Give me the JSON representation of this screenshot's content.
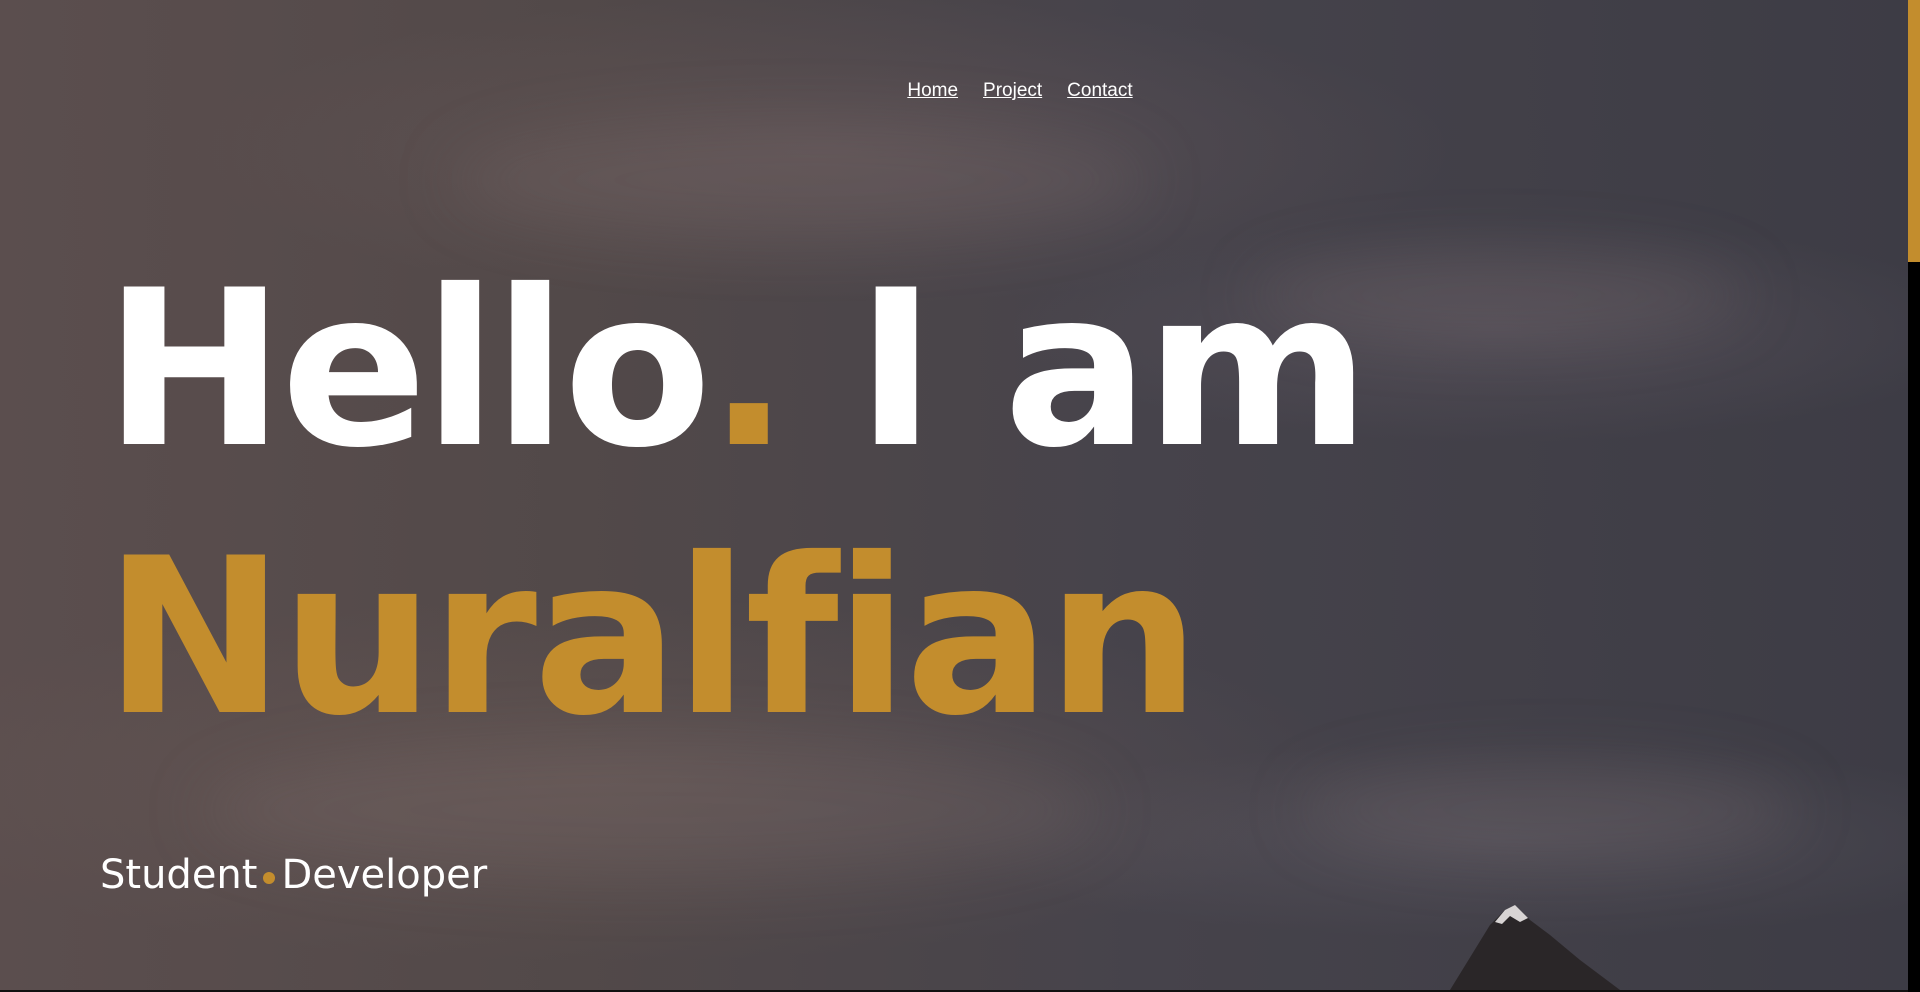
{
  "nav": {
    "items": [
      {
        "label": "Home"
      },
      {
        "label": "Project"
      },
      {
        "label": "Contact"
      }
    ]
  },
  "hero": {
    "greeting": "Hello",
    "greeting_dot": ".",
    "intro": "I am",
    "name": "Nuralfian",
    "roles": [
      "Student",
      "Developer"
    ]
  },
  "colors": {
    "accent": "#c38d2d",
    "text": "#ffffff",
    "background": "#4a4448"
  }
}
